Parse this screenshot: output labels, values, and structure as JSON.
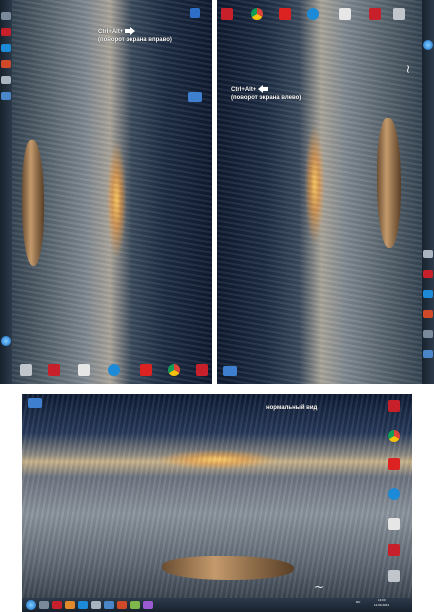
{
  "panels": {
    "rotated_right": {
      "caption_keys": "Ctrl+Alt+",
      "caption_desc": "(поворот экрана вправо)"
    },
    "rotated_left": {
      "caption_keys": "Ctrl+Alt+",
      "caption_desc": "(поворот экрана влево)"
    },
    "normal": {
      "caption": "нормальный вид",
      "tray": {
        "language": "RU",
        "clock_time": "13:00",
        "clock_date": "12.09.2013"
      }
    }
  },
  "colors": {
    "taskbar": "#18222e",
    "caption_text": "#ffffff",
    "icon_red": "#c8202a",
    "icon_blue": "#1c8ad6"
  },
  "icons": [
    "recycle-bin-icon",
    "ccleaner-icon",
    "chrome-icon",
    "skype-icon",
    "opera-icon",
    "wordpad-icon"
  ]
}
